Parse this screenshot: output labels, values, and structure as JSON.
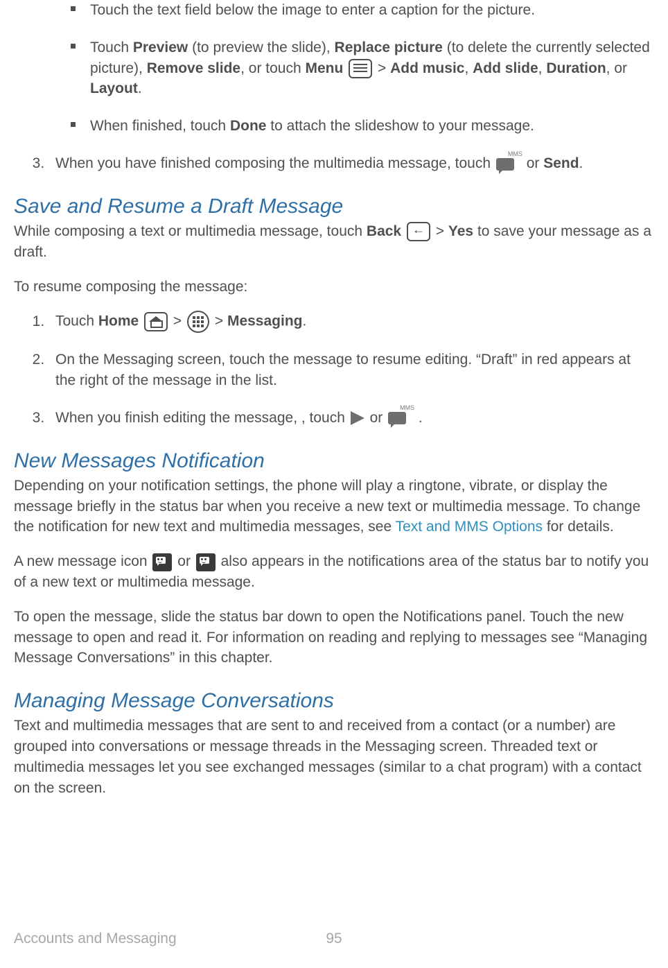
{
  "bullets": {
    "b1": "Touch the text field below the image to enter a caption for the picture.",
    "b2_pre": "Touch ",
    "b2_preview": "Preview",
    "b2_mid1": " (to preview the slide), ",
    "b2_replace": "Replace picture",
    "b2_mid2": " (to delete the currently selected picture), ",
    "b2_remove": "Remove slide",
    "b2_mid3": ", or touch ",
    "b2_menu": "Menu",
    "b2_gt": " > ",
    "b2_add_music": "Add music",
    "b2_comma1": ", ",
    "b2_add_slide": "Add slide",
    "b2_comma2": ", ",
    "b2_duration": "Duration",
    "b2_or": ", or ",
    "b2_layout": "Layout",
    "b2_period": ".",
    "b3_pre": "When finished, touch ",
    "b3_done": "Done",
    "b3_post": " to attach the slideshow to your message."
  },
  "step3a_pre": "When you have finished composing the multimedia message, touch ",
  "step3a_or": " or ",
  "step3a_send": "Send",
  "step3a_period": ".",
  "h_save": "Save and Resume a Draft Message",
  "save_p1_pre": "While composing a text or multimedia message, touch ",
  "save_p1_back": "Back",
  "save_p1_gt": " > ",
  "save_p1_yes": "Yes",
  "save_p1_post": " to save your message as a draft.",
  "save_resume": "To resume composing the message:",
  "save_s1_pre": "Touch ",
  "save_s1_home": "Home",
  "save_s1_gt1": " > ",
  "save_s1_gt2": " > ",
  "save_s1_messaging": "Messaging",
  "save_s1_period": ".",
  "save_s2": "On the Messaging screen, touch the message to resume editing. “Draft” in red appears at the right of the message in the list.",
  "save_s3_pre": "When you finish editing the message, , touch ",
  "save_s3_or": " or ",
  "save_s3_period": " .",
  "h_new": "New Messages Notification",
  "new_p1_pre": "Depending on your notification settings, the phone will play a ringtone, vibrate, or display the message briefly in the status bar when you receive a new text or multimedia message. To change the notification for new text and multimedia messages, see ",
  "new_p1_link": "Text and MMS Options",
  "new_p1_post": " for details.",
  "new_p2_pre": "A new message icon ",
  "new_p2_or": " or ",
  "new_p2_post": " also appears in the notifications area of the status bar to notify you of a new text or multimedia message.",
  "new_p3": "To open the message, slide the status bar down to open the Notifications panel. Touch the new message to open and read it. For information on reading and replying to messages see “Managing Message Conversations” in this chapter.",
  "h_manage": "Managing Message Conversations",
  "manage_p1": "Text and multimedia messages that are sent to and received from a contact (or a number) are grouped into conversations or message threads in the Messaging screen. Threaded text or multimedia messages let you see exchanged messages (similar to a chat program) with a contact on the screen.",
  "footer_chapter": "Accounts and Messaging",
  "footer_page": "95",
  "mms_label": "MMS"
}
